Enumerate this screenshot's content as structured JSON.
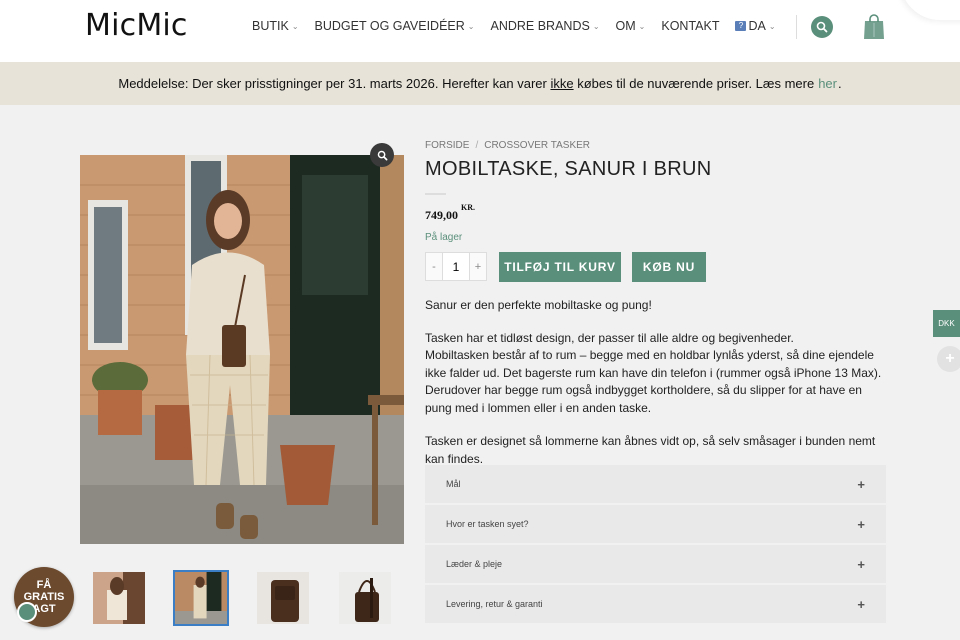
{
  "header": {
    "logo": "MicMic",
    "nav": [
      {
        "label": "BUTIK",
        "has_dropdown": true
      },
      {
        "label": "BUDGET OG GAVEIDÉER",
        "has_dropdown": true
      },
      {
        "label": "ANDRE BRANDS",
        "has_dropdown": true
      },
      {
        "label": "OM",
        "has_dropdown": true
      },
      {
        "label": "KONTAKT",
        "has_dropdown": false
      }
    ],
    "language": {
      "label": "DA",
      "flag_icon": "flag-icon"
    },
    "icons": {
      "search": "search-icon",
      "cart": "shopping-bag-icon"
    },
    "accent_color": "#5a8f7b"
  },
  "notice": {
    "prefix": "Meddelelse: Der sker prisstigninger per 31. marts 2026. Herefter kan varer",
    "underlined": "ikke",
    "middle": "købes til de nuværende priser. Læs mere",
    "link": "her",
    "suffix": "."
  },
  "breadcrumb": {
    "home": "FORSIDE",
    "separator": "/",
    "category": "CROSSOVER TASKER"
  },
  "product": {
    "title": "MOBILTASKE, SANUR I BRUN",
    "price": "749,00",
    "currency": "KR.",
    "stock": "På lager",
    "quantity": "1",
    "minus": "-",
    "plus": "+",
    "add_to_cart": "TILFØJ TIL KURV",
    "buy_now": "KØB NU"
  },
  "description": [
    "Sanur er den perfekte mobiltaske og pung!",
    "Tasken har et tidløst design, der passer til alle aldre og begivenheder.",
    "Mobiltasken består af to rum – begge med en holdbar lynlås yderst, så dine ejendele ikke falder ud. Det bagerste rum kan have din telefon i (rummer også iPhone 13 Max). Derudover har begge rum også indbygget kortholdere, så du slipper for at have en pung med i lommen eller i en anden taske.",
    "Tasken er designet så lommerne kan åbnes vidt op, så selv småsager i bunden nemt kan findes."
  ],
  "accordion": [
    {
      "label": "Mål",
      "icon": "+"
    },
    {
      "label": "Hvor er tasken syet?",
      "icon": "+"
    },
    {
      "label": "Læder & pleje",
      "icon": "+"
    },
    {
      "label": "Levering, retur & garanti",
      "icon": "+"
    }
  ],
  "gallery": {
    "thumbnail_count": 4,
    "active_index": 1
  },
  "side": {
    "currency": "DKK",
    "plus": "+"
  },
  "badge": {
    "line1": "FÅ",
    "line2": "GRATIS",
    "line3": "AGT"
  }
}
